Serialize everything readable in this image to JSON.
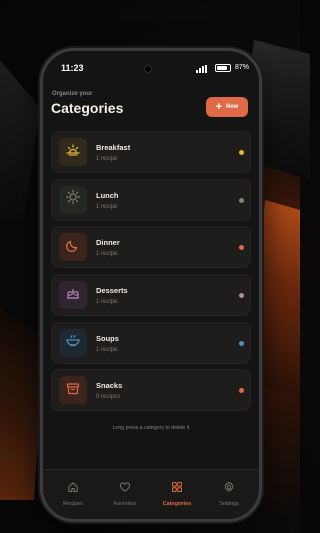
{
  "status_bar": {
    "time": "11:23",
    "battery": "87%",
    "battery_level": 0.87
  },
  "header": {
    "subtitle": "Organize your",
    "title": "Categories",
    "new_button": "New"
  },
  "categories": [
    {
      "name": "Breakfast",
      "count": "1 recipe",
      "icon": "sunrise-icon",
      "color": "#e8b23c",
      "tile_bg": "#2f2a1c"
    },
    {
      "name": "Lunch",
      "count": "1 recipe",
      "icon": "sun-icon",
      "color": "#7f8a66",
      "tile_bg": "#252722"
    },
    {
      "name": "Dinner",
      "count": "1 recipe",
      "icon": "moon-icon",
      "color": "#e06a45",
      "tile_bg": "#3a241d"
    },
    {
      "name": "Desserts",
      "count": "1 recipe",
      "icon": "cake-icon",
      "color": "#b287a8",
      "tile_bg": "#2f2430"
    },
    {
      "name": "Soups",
      "count": "1 recipe",
      "icon": "soup-bowl-icon",
      "color": "#4f8fbf",
      "tile_bg": "#1f2730"
    },
    {
      "name": "Snacks",
      "count": "0 recipes",
      "icon": "snack-box-icon",
      "color": "#e06a45",
      "tile_bg": "#3a241d"
    }
  ],
  "hint": "Long press a category to delete it",
  "tabs": [
    {
      "label": "Recipes",
      "icon": "home-icon",
      "active": false
    },
    {
      "label": "Favorites",
      "icon": "heart-icon",
      "active": false
    },
    {
      "label": "Categories",
      "icon": "grid-icon",
      "active": true
    },
    {
      "label": "Settings",
      "icon": "gear-icon",
      "active": false
    }
  ],
  "colors": {
    "accent": "#e06a45",
    "background": "#151414",
    "card": "#1f1d1c"
  }
}
